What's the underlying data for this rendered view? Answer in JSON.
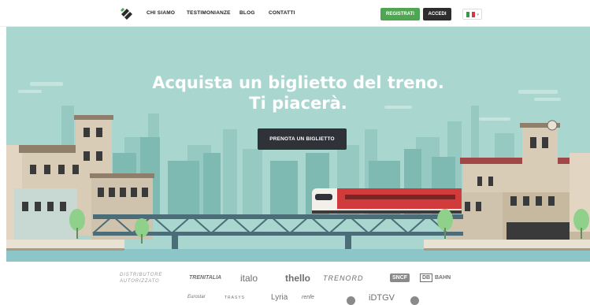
{
  "nav": {
    "links": [
      "CHI SIAMO",
      "TESTIMONIANZE",
      "BLOG",
      "CONTATTI"
    ],
    "register": "REGISTRATI",
    "login": "ACCEDI",
    "language_flag": [
      "#3a9a4a",
      "#ffffff",
      "#d9363e"
    ]
  },
  "hero": {
    "title_line1": "Acquista un biglietto del treno.",
    "title_line2": "Ti piacerà.",
    "cta": "PRENOTA UN BIGLIETTO"
  },
  "partners": {
    "label_line1": "DISTRIBUTORE",
    "label_line2": "AUTORIZZATO",
    "row1": [
      "TRENITALIA",
      "italo",
      "thello",
      "TRENORD",
      "SNCF",
      "DB",
      "BAHN"
    ],
    "row2": [
      "Eurostar",
      "TRASYS",
      "Lyria",
      "renfe",
      "iDTGV"
    ]
  },
  "colors": {
    "accent_green": "#4ea651",
    "dark": "#2d2d2d",
    "sky": "#a9d6cf",
    "train_red": "#d23b3b"
  }
}
